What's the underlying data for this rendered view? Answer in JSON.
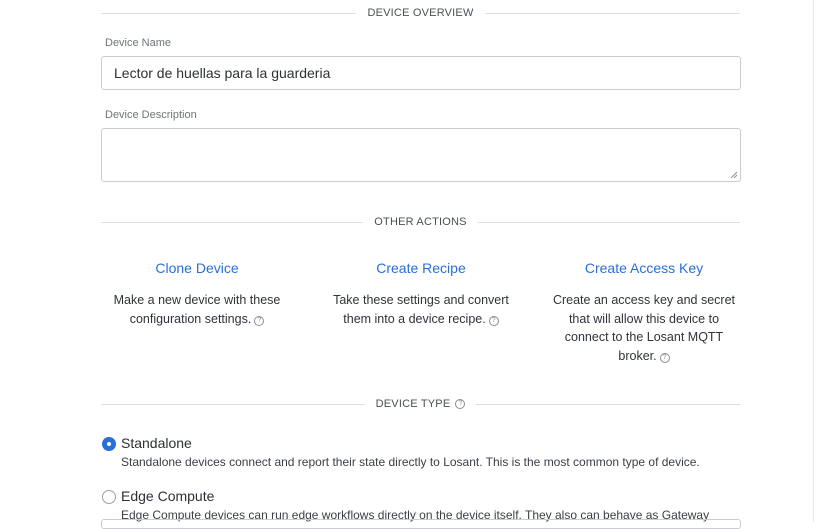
{
  "sections": {
    "overview": "DEVICE OVERVIEW",
    "other_actions": "OTHER ACTIONS",
    "device_type": "DEVICE TYPE"
  },
  "form": {
    "name_label": "Device Name",
    "name_value": "Lector de huellas para la guarderia",
    "description_label": "Device Description",
    "description_value": ""
  },
  "actions": [
    {
      "title": "Clone Device",
      "line1": "Make a new device with these",
      "line2": "configuration settings."
    },
    {
      "title": "Create Recipe",
      "line1": "Take these settings and convert",
      "line2": "them into a device recipe."
    },
    {
      "title": "Create Access Key",
      "line1": "Create an access key and secret",
      "line2": "that will allow this device to",
      "line3": "connect to the Losant MQTT",
      "line4": "broker."
    }
  ],
  "device_types": [
    {
      "label": "Standalone",
      "description": "Standalone devices connect and report their state directly to Losant. This is the most common type of device.",
      "selected": true
    },
    {
      "label": "Edge Compute",
      "description": "Edge Compute devices can run edge workflows directly on the device itself. They also can behave as Gateway",
      "selected": false
    }
  ],
  "icons": {
    "help": "help-circle-icon",
    "radio_selected": "radio-selected-icon",
    "radio_unselected": "radio-unselected-icon"
  },
  "colors": {
    "link": "#2a6fd6",
    "radio_active": "#2a6fd6",
    "divider": "#dcdfe4"
  }
}
